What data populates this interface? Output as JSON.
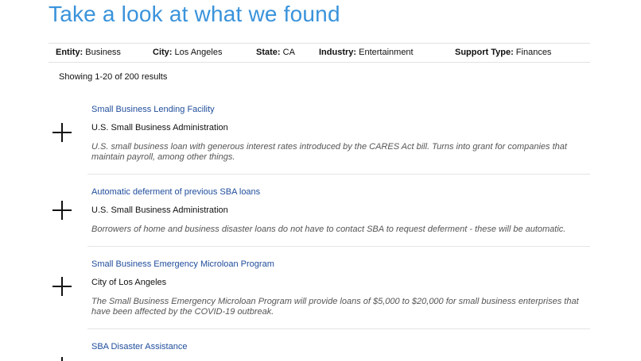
{
  "header": {
    "title": "Take a look at what we found"
  },
  "filters": {
    "entity": {
      "label": "Entity:",
      "value": "Business"
    },
    "city": {
      "label": "City:",
      "value": "Los Angeles"
    },
    "state": {
      "label": "State:",
      "value": "CA"
    },
    "industry": {
      "label": "Industry:",
      "value": "Entertainment"
    },
    "support_type": {
      "label": "Support Type:",
      "value": "Finances"
    }
  },
  "results_summary": "Showing 1-20 of 200 results",
  "results": [
    {
      "title": "Small Business Lending Facility",
      "organization": "U.S. Small Business Administration",
      "description": "U.S. small business loan with generous interest rates introduced by the CARES Act bill. Turns into grant for companies that maintain payroll, among other things."
    },
    {
      "title": "Automatic deferment of previous SBA loans",
      "organization": "U.S. Small Business Administration",
      "description": "Borrowers of home and business disaster loans do not have to contact SBA to request deferment - these will be automatic."
    },
    {
      "title": "Small Business Emergency Microloan Program",
      "organization": "City of Los Angeles",
      "description": "The Small Business Emergency Microloan Program will provide loans of $5,000 to $20,000 for small business enterprises that have been affected by the COVID-19 outbreak."
    },
    {
      "title": "SBA Disaster Assistance",
      "organization": "",
      "description": ""
    }
  ],
  "colors": {
    "title": "#3a93db",
    "link": "#1f4d9b",
    "description": "#555555",
    "divider": "#e4e4e4"
  },
  "icons": {
    "expand": "plus-icon"
  }
}
